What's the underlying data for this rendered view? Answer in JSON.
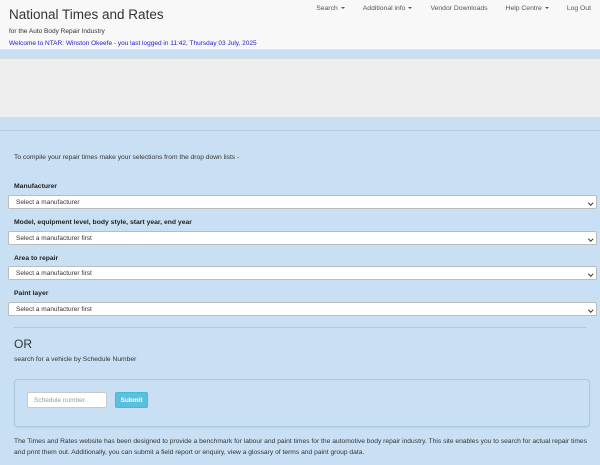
{
  "header": {
    "title": "National Times and Rates",
    "subtitle": "for the Auto Body Repair Industry",
    "welcome": "Welcome to NTAR: Winston Okeefe - you last logged in 11:42, Thursday 03 July, 2025"
  },
  "nav": {
    "items": [
      {
        "label": "Search",
        "dropdown": true
      },
      {
        "label": "Additional info",
        "dropdown": true
      },
      {
        "label": "Vendor Downloads",
        "dropdown": false
      },
      {
        "label": "Help Centre",
        "dropdown": true
      },
      {
        "label": "Log Out",
        "dropdown": false
      }
    ]
  },
  "form": {
    "intro": "To compile your repair times make your selections from the drop down lists -",
    "fields": [
      {
        "label": "Manufacturer",
        "value": "Select a manufacturer"
      },
      {
        "label": "Model, equipment level, body style, start year, end year",
        "value": "Select a manufacturer first"
      },
      {
        "label": "Area to repair",
        "value": "Select a manufacturer first"
      },
      {
        "label": "Paint layer",
        "value": "Select a manufacturer first"
      }
    ],
    "or_text": "OR",
    "schedule_prompt": "search for a vehicle by Schedule Number",
    "schedule_placeholder": "Schedule number",
    "submit_label": "Submit"
  },
  "footer": {
    "text": "The Times and Rates website has been designed to provide a benchmark for labour and paint times for the automotive body repair industry. This site enables you to search for actual repair times and print them out. Additionally, you can submit a field report or enquiry, view a glossary of terms and paint group data."
  },
  "colors": {
    "page_bg": "#c9e0f4",
    "welcome_text": "#1f17d6",
    "submit_bg": "#5bc0de"
  }
}
